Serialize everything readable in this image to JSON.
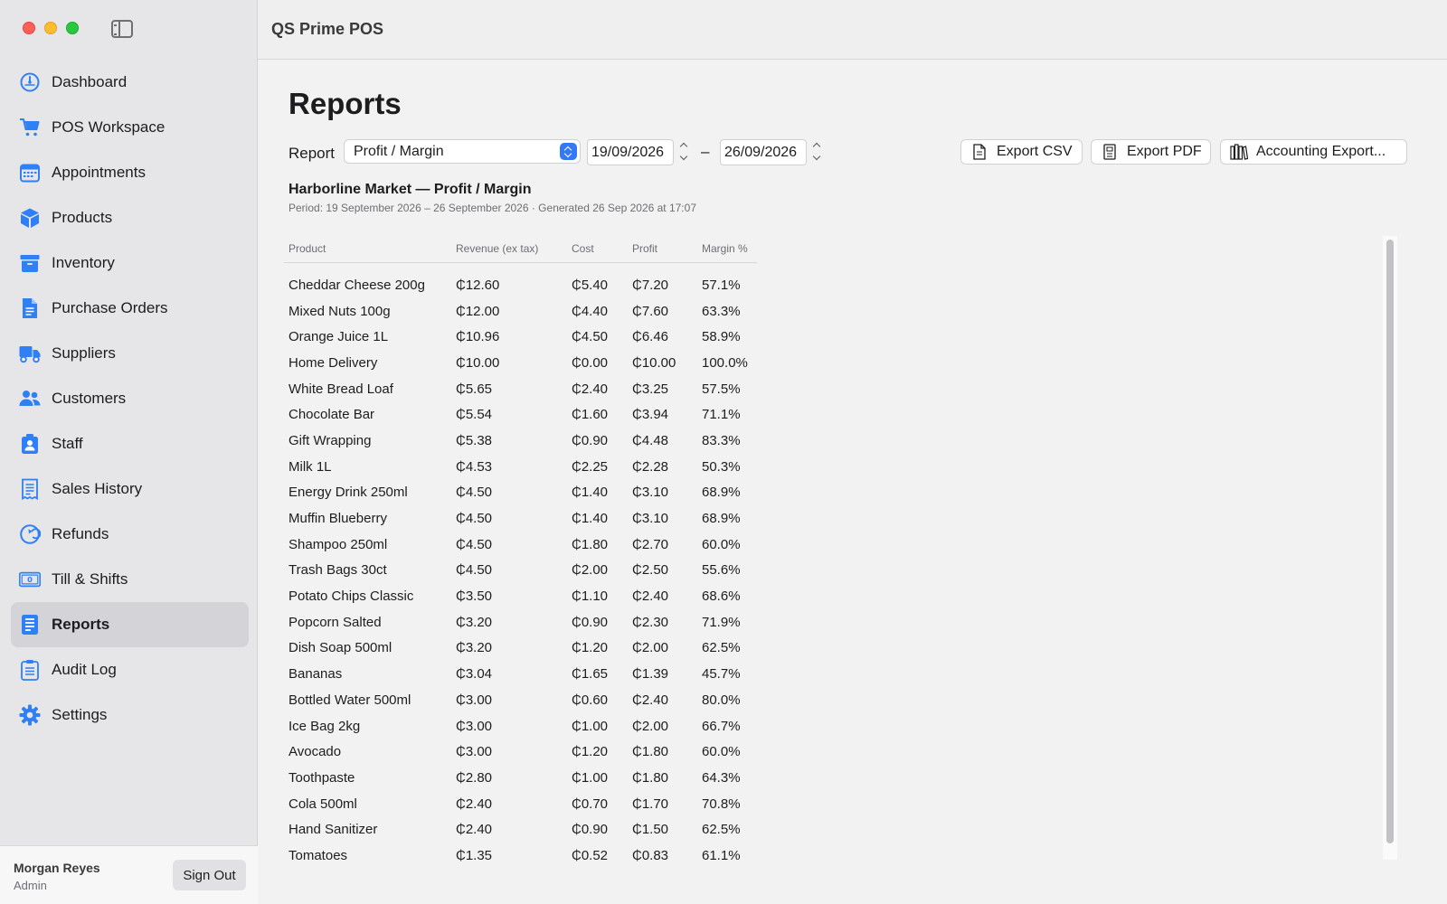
{
  "app": {
    "title": "QS Prime POS"
  },
  "sidebar": {
    "items": [
      {
        "label": "Dashboard",
        "icon": "dashboard-icon"
      },
      {
        "label": "POS Workspace",
        "icon": "cart-icon"
      },
      {
        "label": "Appointments",
        "icon": "calendar-icon"
      },
      {
        "label": "Products",
        "icon": "box-icon"
      },
      {
        "label": "Inventory",
        "icon": "archive-icon"
      },
      {
        "label": "Purchase Orders",
        "icon": "document-icon"
      },
      {
        "label": "Suppliers",
        "icon": "truck-icon"
      },
      {
        "label": "Customers",
        "icon": "people-icon"
      },
      {
        "label": "Staff",
        "icon": "badge-icon"
      },
      {
        "label": "Sales History",
        "icon": "receipt-icon"
      },
      {
        "label": "Refunds",
        "icon": "refund-icon"
      },
      {
        "label": "Till & Shifts",
        "icon": "cash-icon"
      },
      {
        "label": "Reports",
        "icon": "reports-icon",
        "active": true
      },
      {
        "label": "Audit Log",
        "icon": "clipboard-icon"
      },
      {
        "label": "Settings",
        "icon": "gear-icon"
      }
    ],
    "user": {
      "name": "Morgan Reyes",
      "role": "Admin",
      "signout_label": "Sign Out"
    }
  },
  "main": {
    "title": "Reports",
    "toolbar": {
      "report_label": "Report",
      "report_type": "Profit / Margin",
      "date_from": "19/09/2026",
      "date_separator": "–",
      "date_to": "26/09/2026",
      "export_csv": "Export CSV",
      "export_pdf": "Export PDF",
      "accounting_export": "Accounting Export..."
    },
    "report": {
      "heading": "Harborline Market — Profit / Margin",
      "subheading": "Period: 19 September 2026 – 26 September 2026 · Generated 26 Sep 2026 at 17:07",
      "columns": [
        "Product",
        "Revenue (ex tax)",
        "Cost",
        "Profit",
        "Margin %"
      ],
      "rows": [
        [
          "Cheddar Cheese 200g",
          "₵12.60",
          "₵5.40",
          "₵7.20",
          "57.1%"
        ],
        [
          "Mixed Nuts 100g",
          "₵12.00",
          "₵4.40",
          "₵7.60",
          "63.3%"
        ],
        [
          "Orange Juice 1L",
          "₵10.96",
          "₵4.50",
          "₵6.46",
          "58.9%"
        ],
        [
          "Home Delivery",
          "₵10.00",
          "₵0.00",
          "₵10.00",
          "100.0%"
        ],
        [
          "White Bread Loaf",
          "₵5.65",
          "₵2.40",
          "₵3.25",
          "57.5%"
        ],
        [
          "Chocolate Bar",
          "₵5.54",
          "₵1.60",
          "₵3.94",
          "71.1%"
        ],
        [
          "Gift Wrapping",
          "₵5.38",
          "₵0.90",
          "₵4.48",
          "83.3%"
        ],
        [
          "Milk 1L",
          "₵4.53",
          "₵2.25",
          "₵2.28",
          "50.3%"
        ],
        [
          "Energy Drink 250ml",
          "₵4.50",
          "₵1.40",
          "₵3.10",
          "68.9%"
        ],
        [
          "Muffin Blueberry",
          "₵4.50",
          "₵1.40",
          "₵3.10",
          "68.9%"
        ],
        [
          "Shampoo 250ml",
          "₵4.50",
          "₵1.80",
          "₵2.70",
          "60.0%"
        ],
        [
          "Trash Bags 30ct",
          "₵4.50",
          "₵2.00",
          "₵2.50",
          "55.6%"
        ],
        [
          "Potato Chips Classic",
          "₵3.50",
          "₵1.10",
          "₵2.40",
          "68.6%"
        ],
        [
          "Popcorn Salted",
          "₵3.20",
          "₵0.90",
          "₵2.30",
          "71.9%"
        ],
        [
          "Dish Soap 500ml",
          "₵3.20",
          "₵1.20",
          "₵2.00",
          "62.5%"
        ],
        [
          "Bananas",
          "₵3.04",
          "₵1.65",
          "₵1.39",
          "45.7%"
        ],
        [
          "Bottled Water 500ml",
          "₵3.00",
          "₵0.60",
          "₵2.40",
          "80.0%"
        ],
        [
          "Ice Bag 2kg",
          "₵3.00",
          "₵1.00",
          "₵2.00",
          "66.7%"
        ],
        [
          "Avocado",
          "₵3.00",
          "₵1.20",
          "₵1.80",
          "60.0%"
        ],
        [
          "Toothpaste",
          "₵2.80",
          "₵1.00",
          "₵1.80",
          "64.3%"
        ],
        [
          "Cola 500ml",
          "₵2.40",
          "₵0.70",
          "₵1.70",
          "70.8%"
        ],
        [
          "Hand Sanitizer",
          "₵2.40",
          "₵0.90",
          "₵1.50",
          "62.5%"
        ],
        [
          "Tomatoes",
          "₵1.35",
          "₵0.52",
          "₵0.83",
          "61.1%"
        ]
      ]
    }
  },
  "colors": {
    "accent": "#3478f6",
    "icon_blue": "#2f7ff5"
  }
}
